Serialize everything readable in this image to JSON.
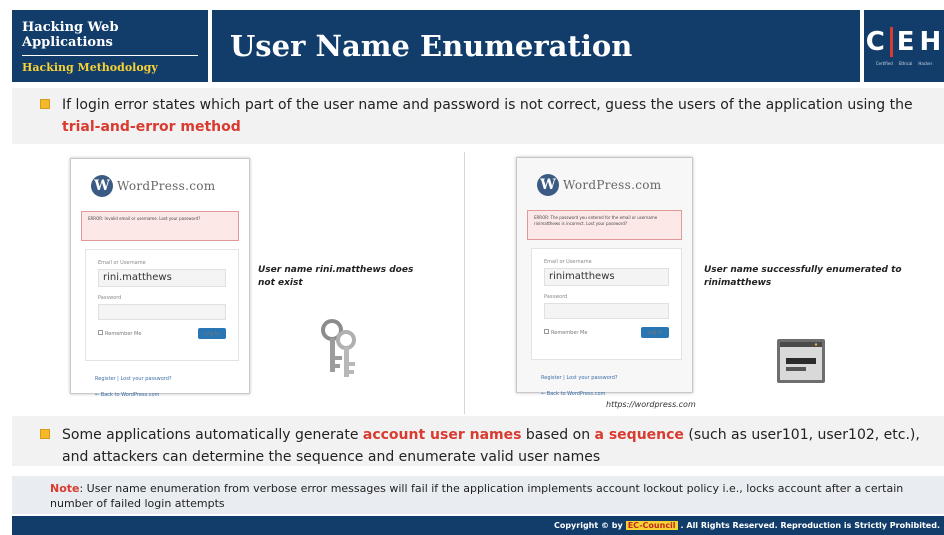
{
  "header": {
    "course": "Hacking Web Applications",
    "module": "Hacking Methodology",
    "title": "User Name Enumeration",
    "logo_letters": [
      "C",
      "E",
      "H"
    ],
    "logo_sub": [
      "Certified",
      "Ethical",
      "Hacker"
    ]
  },
  "bullets": [
    {
      "text_before": "If login error states which part of the user name and password is not correct, guess the users of the application using the ",
      "highlight": "trial-and-error method",
      "text_after": ""
    },
    {
      "text_before": "Some applications automatically generate ",
      "highlight1": "account user names",
      "text_mid": " based on ",
      "highlight2": "a sequence",
      "text_after": " (such as user101, user102, etc.), and attackers can determine the sequence and enumerate valid user names"
    }
  ],
  "screenshot_left": {
    "brand": "WordPress.com",
    "error_text": "ERROR: Invalid email or username. Lost your password?",
    "email_label": "Email or Username",
    "email_value": "rini.matthews",
    "password_label": "Password",
    "remember_label": "Remember Me",
    "login_button": "Log In",
    "link_register": "Register | Lost your password?",
    "link_back": "← Back to WordPress.com",
    "caption": "User name rini.matthews does not exist"
  },
  "screenshot_right": {
    "brand": "WordPress.com",
    "error_text": "ERROR: The password you entered for the email or username rinimatthews is incorrect. Lost your password?",
    "email_label": "Email or Username",
    "email_value": "rinimatthews",
    "password_label": "Password",
    "remember_label": "Remember Me",
    "login_button": "Log In",
    "link_register": "Register | Lost your password?",
    "link_back": "← Back to WordPress.com",
    "caption": "User name successfully enumerated to rinimatthews"
  },
  "source_url": "https://wordpress.com",
  "note": {
    "label": "Note",
    "text": ": User name enumeration from verbose error messages will fail if the application implements account lockout policy i.e., locks account after a certain number of failed login attempts"
  },
  "footer": {
    "prefix": "Copyright © by",
    "brand": "EC-Council",
    "suffix": ". All Rights Reserved. Reproduction is Strictly Prohibited."
  },
  "colors": {
    "navy": "#123d6b",
    "accent_red": "#d93b30",
    "bullet": "#f4b829",
    "module_yellow": "#f6d234"
  }
}
